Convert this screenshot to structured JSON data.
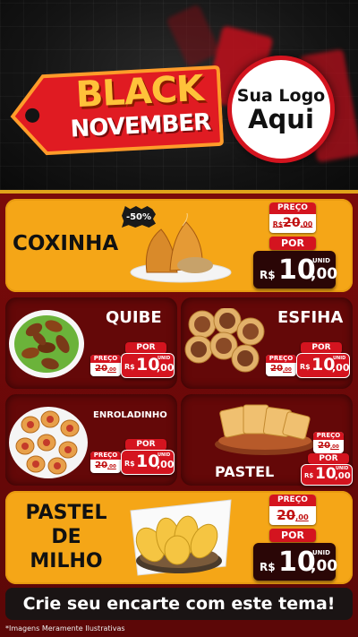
{
  "header": {
    "tag_line1": "BLACK",
    "tag_line2": "NOVEMBER",
    "logo_line1": "Sua Logo",
    "logo_line2": "Aqui"
  },
  "labels": {
    "preco": "PREÇO",
    "por": "POR",
    "currency": "R$",
    "unid": "UNID"
  },
  "products": [
    {
      "name": "COXINHA",
      "old_int": "20",
      "old_dec": ",00",
      "new_int": "10",
      "new_dec": ",00",
      "badge": "-50%"
    },
    {
      "name": "QUIBE",
      "old_int": "20",
      "old_dec": ",00",
      "new_int": "10",
      "new_dec": ",00"
    },
    {
      "name": "ESFIHA",
      "old_int": "20",
      "old_dec": ",00",
      "new_int": "10",
      "new_dec": ",00"
    },
    {
      "name": "ENROLADINHO",
      "old_int": "20",
      "old_dec": ",00",
      "new_int": "10",
      "new_dec": ",00"
    },
    {
      "name": "PASTEL",
      "old_int": "20",
      "old_dec": ",00",
      "new_int": "10",
      "new_dec": ",00"
    },
    {
      "name_line1": "PASTEL",
      "name_line2": "DE",
      "name_line3": "MILHO",
      "old_int": "20",
      "old_dec": ",00",
      "new_int": "10",
      "new_dec": ",00"
    }
  ],
  "banner": "Crie seu encarte com este tema!",
  "footnote": "*Imagens Meramente Ilustrativas",
  "colors": {
    "brand_red": "#d4141f",
    "brand_yellow": "#f5a617",
    "dark_red": "#640808"
  }
}
